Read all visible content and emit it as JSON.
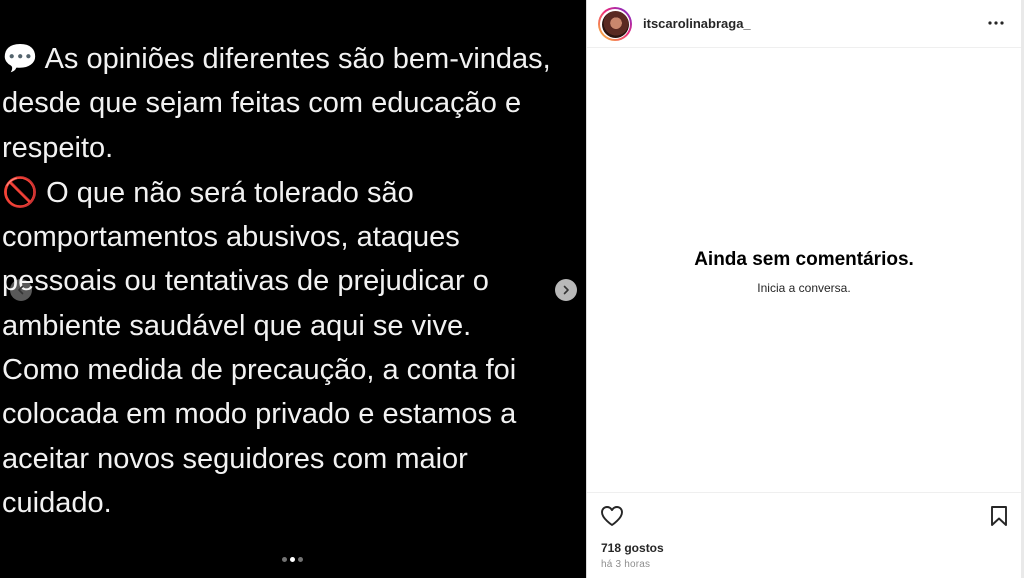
{
  "post": {
    "lines": [
      {
        "emoji": "💬",
        "text": " As opiniões diferentes são bem-vindas,"
      },
      {
        "emoji": "",
        "text": "desde que sejam feitas com educação e"
      },
      {
        "emoji": "",
        "text": "respeito."
      },
      {
        "emoji": "🚫",
        "text": " O que não será tolerado são"
      },
      {
        "emoji": "",
        "text": "comportamentos abusivos, ataques"
      },
      {
        "emoji": "",
        "text": "pessoais ou tentativas de prejudicar o"
      },
      {
        "emoji": "",
        "text": "ambiente saudável que aqui se vive."
      },
      {
        "emoji": "",
        "text": "Como medida de precaução, a conta foi"
      },
      {
        "emoji": "",
        "text": "colocada em modo privado e estamos a"
      },
      {
        "emoji": "",
        "text": "aceitar novos seguidores com maior"
      },
      {
        "emoji": "",
        "text": "cuidado."
      }
    ],
    "carousel": {
      "total": 3,
      "active_index": 1
    }
  },
  "header": {
    "username": "itscarolinabraga_"
  },
  "comments": {
    "empty_title": "Ainda sem comentários.",
    "empty_subtitle": "Inicia a conversa."
  },
  "footer": {
    "likes": "718 gostos",
    "time": "há 3 horas"
  },
  "icons": {
    "prev": "chevron-left-icon",
    "next": "chevron-right-icon",
    "more": "more-horizontal-icon",
    "like": "heart-icon",
    "save": "bookmark-icon"
  },
  "colors": {
    "media_bg": "#000000",
    "text": "#262626",
    "muted": "#8e8e8e"
  }
}
